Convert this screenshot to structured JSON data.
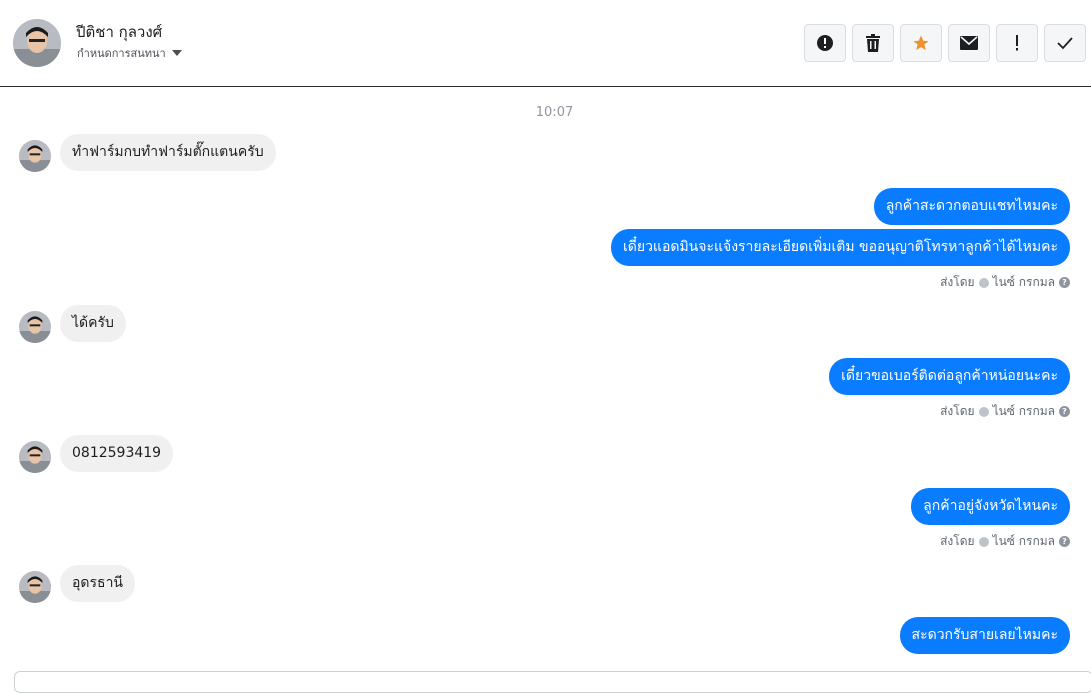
{
  "header": {
    "contact_name": "ปีติชา กุลวงศ์",
    "conversation_setting": "กำหนดการสนทนา",
    "toolbar": [
      {
        "icon": "alert-circle-icon",
        "name": "mark-spam-button"
      },
      {
        "icon": "trash-icon",
        "name": "delete-button"
      },
      {
        "icon": "star-icon",
        "name": "star-button",
        "color": "#f0922b"
      },
      {
        "icon": "envelope-icon",
        "name": "mark-unread-button"
      },
      {
        "icon": "exclamation-icon",
        "name": "important-button"
      },
      {
        "icon": "check-icon",
        "name": "done-button"
      }
    ]
  },
  "conversation": {
    "timestamp": "10:07",
    "sent_by_label": "ส่งโดย",
    "sent_by_name": "ไนซ์ กรกมล",
    "messages": [
      {
        "direction": "in",
        "text": "ทำฟาร์มกบทำฟาร์มตั๊กแตนครับ"
      },
      {
        "direction": "out",
        "text": "ลูกค้าสะดวกตอบแชทไหมคะ"
      },
      {
        "direction": "out",
        "text": "เดี๋ยวแอดมินจะแจ้งรายละเอียดเพิ่มเติม ขออนุญาติโทรหาลูกค้าได้ไหมคะ"
      },
      {
        "direction": "in",
        "text": "ได้ครับ"
      },
      {
        "direction": "out",
        "text": "เดี๋ยวขอเบอร์ติดต่อลูกค้าหน่อยนะคะ"
      },
      {
        "direction": "in",
        "text": "0812593419"
      },
      {
        "direction": "out",
        "text": "ลูกค้าอยู่จังหวัดไหนคะ"
      },
      {
        "direction": "in",
        "text": "อุดรธานี"
      },
      {
        "direction": "out",
        "text": "สะดวกรับสายเลยไหมคะ"
      }
    ]
  },
  "colors": {
    "outgoing_bubble": "#0a7cff",
    "incoming_bubble": "#f0f0f0",
    "star": "#f0922b"
  }
}
